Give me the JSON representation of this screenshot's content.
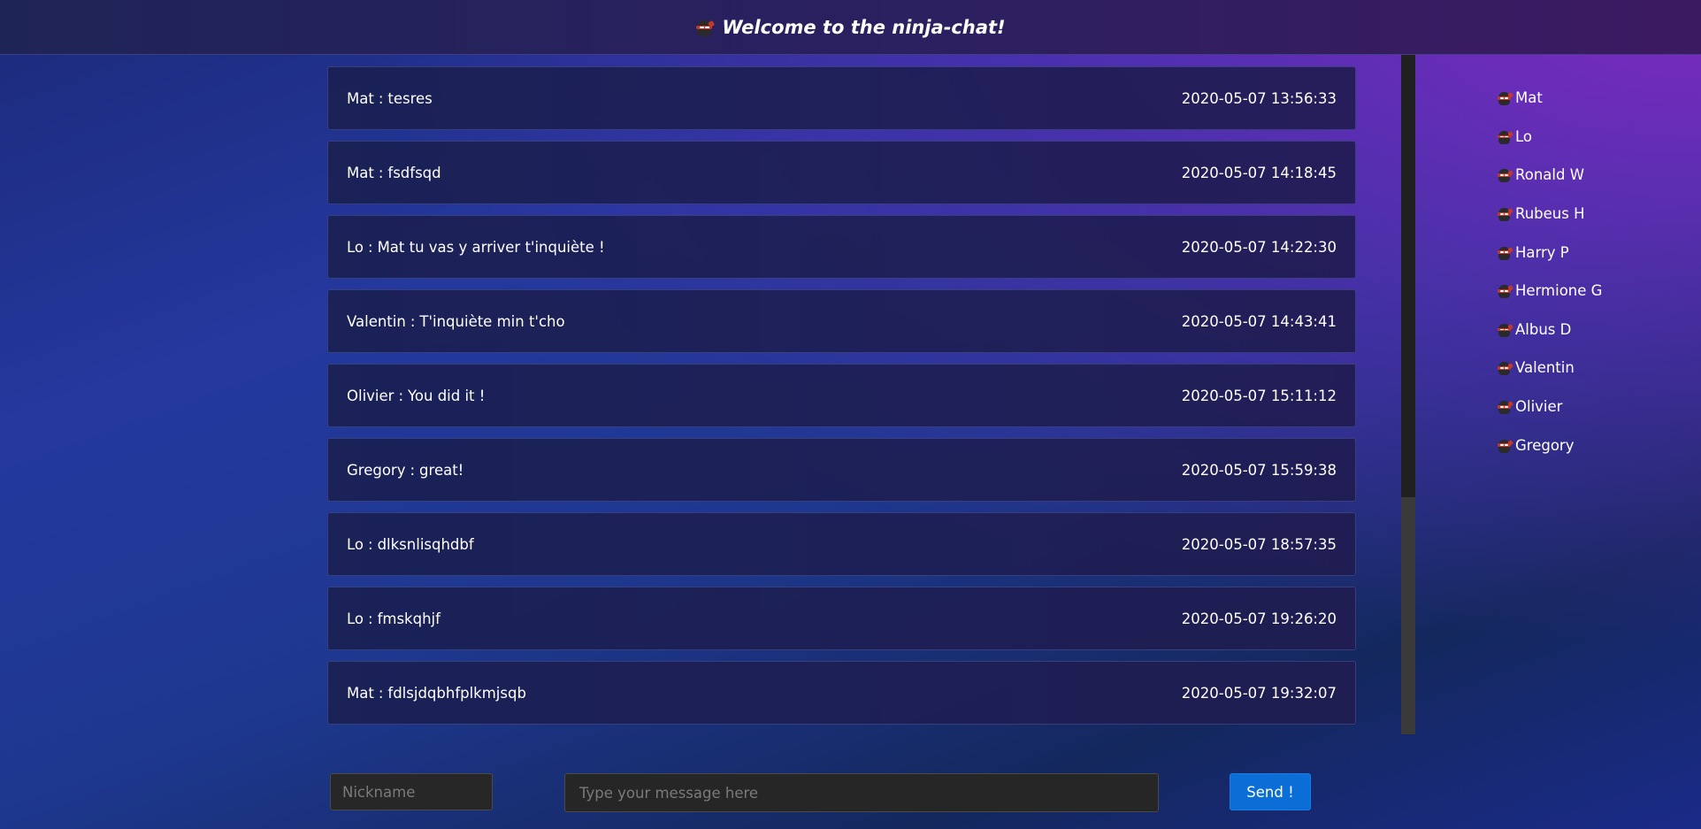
{
  "header": {
    "title": "Welcome to the ninja-chat!",
    "icon": "ninja-icon"
  },
  "messages": [
    {
      "author": "Mat",
      "text": "tesres",
      "time": "2020-05-07 13:56:33"
    },
    {
      "author": "Mat",
      "text": "fsdfsqd",
      "time": "2020-05-07 14:18:45"
    },
    {
      "author": "Lo",
      "text": "Mat tu vas y arriver t'inquiète !",
      "time": "2020-05-07 14:22:30"
    },
    {
      "author": "Valentin",
      "text": "T'inquiète min t'cho",
      "time": "2020-05-07 14:43:41"
    },
    {
      "author": "Olivier",
      "text": "You did it !",
      "time": "2020-05-07 15:11:12"
    },
    {
      "author": "Gregory",
      "text": "great!",
      "time": "2020-05-07 15:59:38"
    },
    {
      "author": "Lo",
      "text": "dlksnlisqhdbf",
      "time": "2020-05-07 18:57:35"
    },
    {
      "author": "Lo",
      "text": "fmskqhjf",
      "time": "2020-05-07 19:26:20"
    },
    {
      "author": "Mat",
      "text": "fdlsjdqbhfplkmjsqb",
      "time": "2020-05-07 19:32:07"
    }
  ],
  "separator": ":",
  "users": [
    "Mat",
    "Lo",
    "Ronald W",
    "Rubeus H",
    "Harry P",
    "Hermione G",
    "Albus D",
    "Valentin",
    "Olivier",
    "Gregory"
  ],
  "composer": {
    "nickname_placeholder": "Nickname",
    "nickname_value": "",
    "message_placeholder": "Type your message here",
    "message_value": "",
    "send_label": "Send !"
  },
  "colors": {
    "send_button": "#0b6ed6",
    "ninja_band": "#c0392b"
  }
}
